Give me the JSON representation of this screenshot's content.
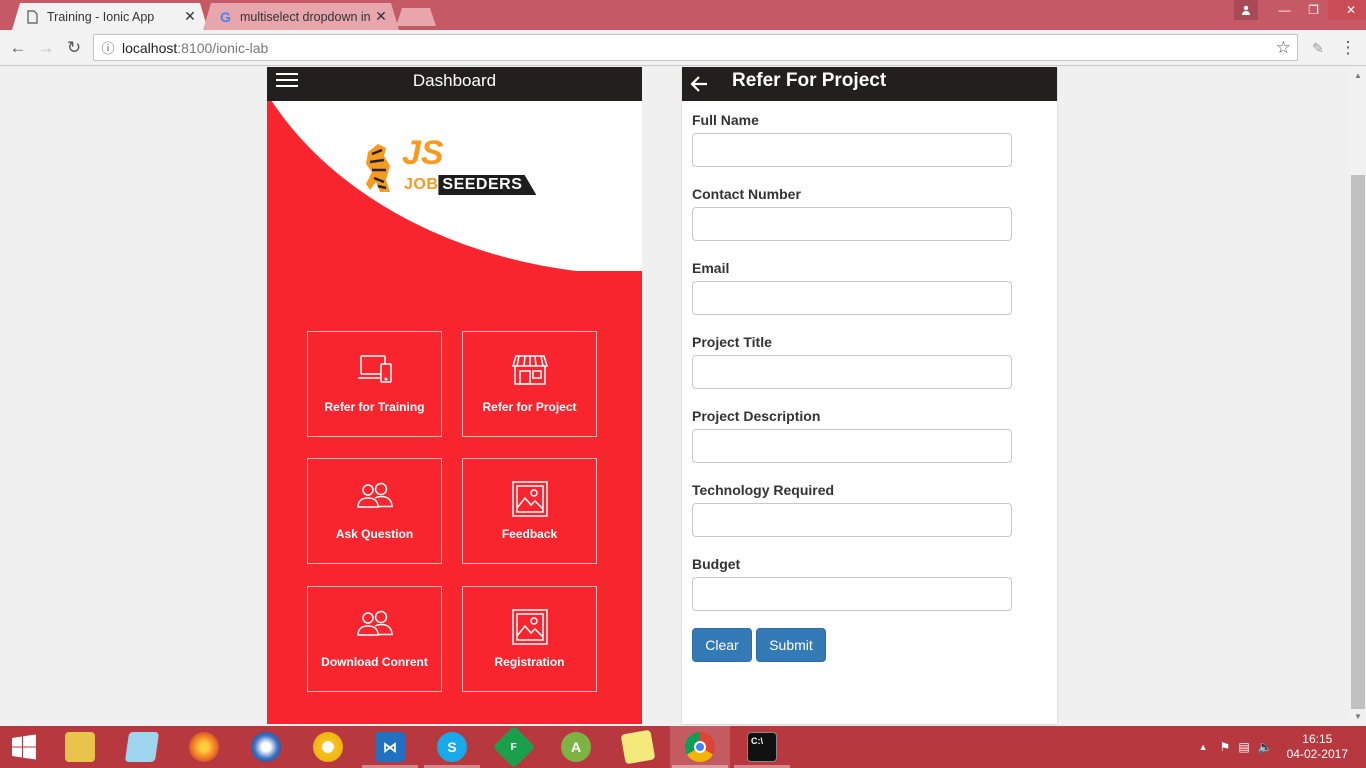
{
  "browser": {
    "tabs": [
      {
        "title": "Training - Ionic App",
        "active": true
      },
      {
        "title": "multiselect dropdown in",
        "active": false
      }
    ],
    "url_host": "localhost",
    "url_path": ":8100/ionic-lab"
  },
  "left_app": {
    "header_title": "Dashboard",
    "logo": {
      "js": "JS",
      "job": "JOB",
      "seeders": "SEEDERS"
    },
    "tiles": [
      {
        "label": "Refer for Training",
        "icon": "devices-icon"
      },
      {
        "label": "Refer for Project",
        "icon": "store-icon"
      },
      {
        "label": "Ask Question",
        "icon": "people-icon"
      },
      {
        "label": "Feedback",
        "icon": "image-icon"
      },
      {
        "label": "Download Conrent",
        "icon": "people-icon"
      },
      {
        "label": "Registration",
        "icon": "image-icon"
      }
    ],
    "colors": {
      "accent": "#f8252e",
      "header": "#231f1f"
    }
  },
  "right_app": {
    "header_title": "Refer For Project",
    "fields": [
      {
        "label": "Full Name",
        "value": ""
      },
      {
        "label": "Contact Number",
        "value": ""
      },
      {
        "label": "Email",
        "value": ""
      },
      {
        "label": "Project Title",
        "value": ""
      },
      {
        "label": "Project Description",
        "value": ""
      },
      {
        "label": "Technology Required",
        "value": ""
      },
      {
        "label": "Budget",
        "value": ""
      }
    ],
    "buttons": {
      "clear": "Clear",
      "submit": "Submit"
    },
    "colors": {
      "button": "#337ab7"
    }
  },
  "taskbar": {
    "apps": [
      "file-explorer-icon",
      "notepad-icon",
      "firefox-icon",
      "thunderbird-icon",
      "chrome-canary-icon",
      "visual-studio-icon",
      "skype-icon",
      "filezilla-icon",
      "android-studio-icon",
      "sticky-notes-icon",
      "chrome-icon",
      "cmd-icon"
    ],
    "time": "16:15",
    "date": "04-02-2017"
  }
}
